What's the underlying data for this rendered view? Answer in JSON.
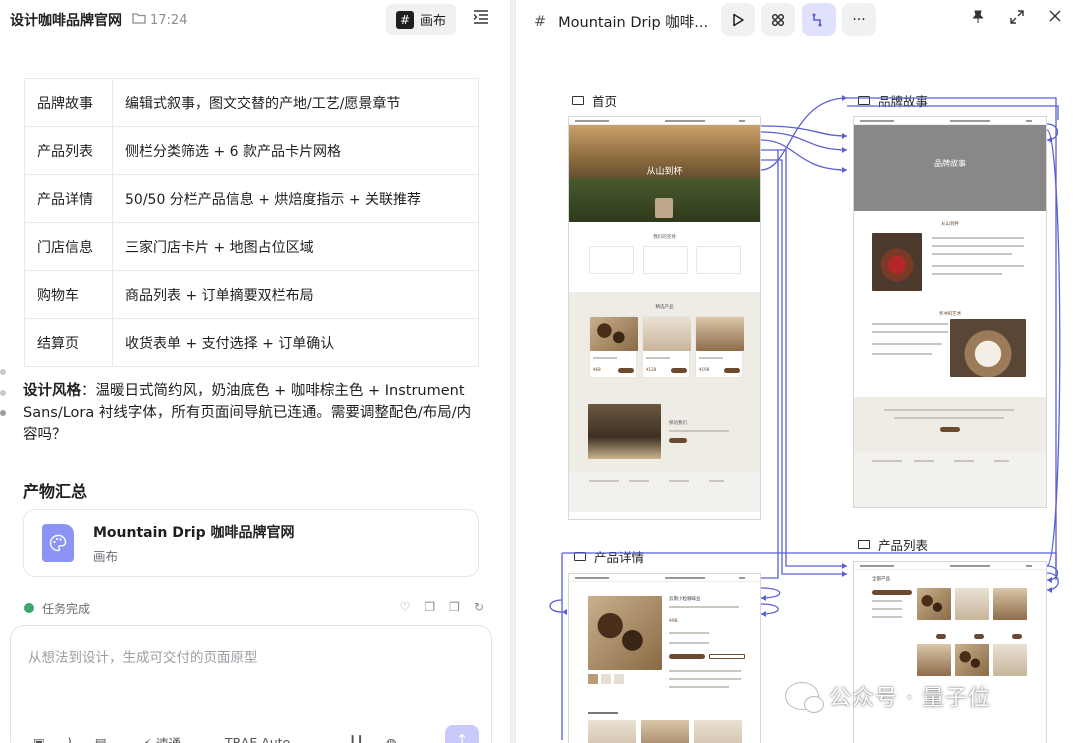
{
  "left": {
    "title": "设计咖啡品牌官网",
    "time": "17:24",
    "canvas_button": "画布",
    "table": [
      {
        "page": "品牌故事",
        "desc": "编辑式叙事，图文交替的产地/工艺/愿景章节"
      },
      {
        "page": "产品列表",
        "desc": "侧栏分类筛选 + 6 款产品卡片网格"
      },
      {
        "page": "产品详情",
        "desc": "50/50 分栏产品信息 + 烘焙度指示 + 关联推荐"
      },
      {
        "page": "门店信息",
        "desc": "三家门店卡片 + 地图占位区域"
      },
      {
        "page": "购物车",
        "desc": "商品列表 + 订单摘要双栏布局"
      },
      {
        "page": "结算页",
        "desc": "收货表单 + 支付选择 + 订单确认"
      }
    ],
    "style_label": "设计风格",
    "style_text": "：温暖日式简约风，奶油底色 + 咖啡棕主色 + Instrument Sans/Lora 衬线字体，所有页面间导航已连通。需要调整配色/布局/内容吗？",
    "outputs_title": "产物汇总",
    "card": {
      "name": "Mountain Drip 咖啡品牌官网",
      "type": "画布"
    },
    "status_text": "任务完成",
    "input_placeholder": "从想法到设计，生成可交付的页面原型",
    "tools": {
      "mode": "速通",
      "model": "TRAE Auto"
    }
  },
  "right": {
    "title": "Mountain Drip 咖啡...",
    "frames": {
      "home": {
        "label": "首页",
        "hero": "从山到杯",
        "sections": [
          "我们的坚持",
          "精选产品",
          "探访我们"
        ],
        "prices": [
          "¥68",
          "¥128",
          "¥198"
        ]
      },
      "story": {
        "label": "品牌故事",
        "hero": "品牌故事",
        "sections": [
          "从山到杯",
          "手冲的艺术"
        ]
      },
      "detail": {
        "label": "产品详情",
        "product": "云南小粒咖啡豆",
        "price": "¥98"
      },
      "list": {
        "label": "产品列表",
        "heading": "全部产品"
      }
    },
    "watermark": "公众号 · 量子位"
  },
  "colors": {
    "accent": "#5b5fd6",
    "link": "#5b5fd6",
    "brown": "#6b4a30",
    "cream": "#efece6"
  }
}
